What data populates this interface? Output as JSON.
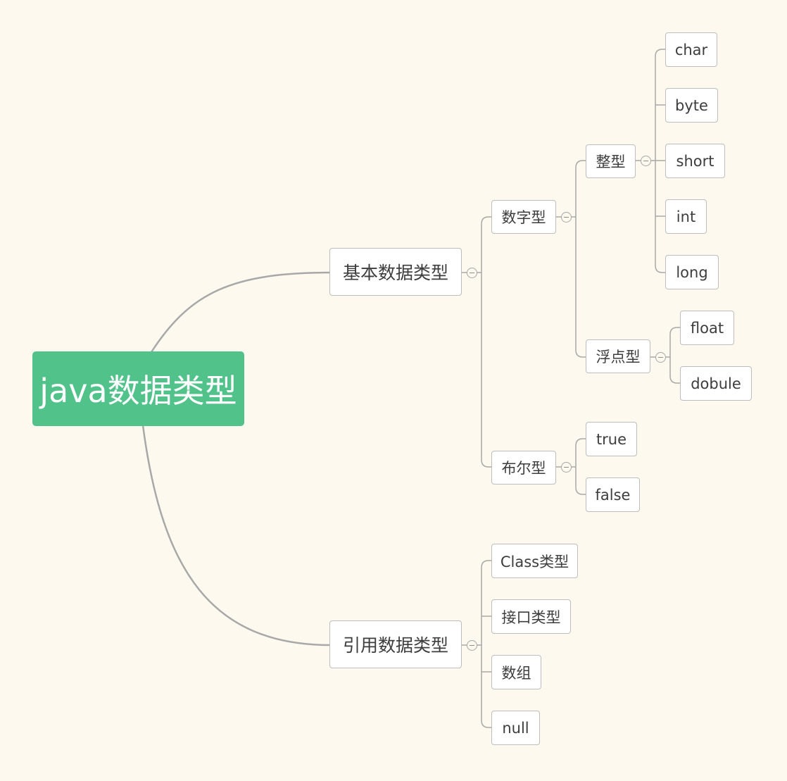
{
  "colors": {
    "background": "#fdf9ee",
    "root_fill": "#50c28a",
    "root_text": "#ffffff",
    "line": "#a8a8a8",
    "node_border": "#bdbdbd",
    "node_text": "#3d3d3d"
  },
  "mindmap": {
    "root": "java数据类型",
    "branches": [
      {
        "label": "基本数据类型",
        "children": [
          {
            "label": "数字型",
            "children": [
              {
                "label": "整型",
                "children": [
                  "char",
                  "byte",
                  "short",
                  "int",
                  "long"
                ]
              },
              {
                "label": "浮点型",
                "children": [
                  "float",
                  "dobule"
                ]
              }
            ]
          },
          {
            "label": "布尔型",
            "children": [
              "true",
              "false"
            ]
          }
        ]
      },
      {
        "label": "引用数据类型",
        "children": [
          "Class类型",
          "接口类型",
          "数组",
          "null"
        ]
      }
    ]
  }
}
